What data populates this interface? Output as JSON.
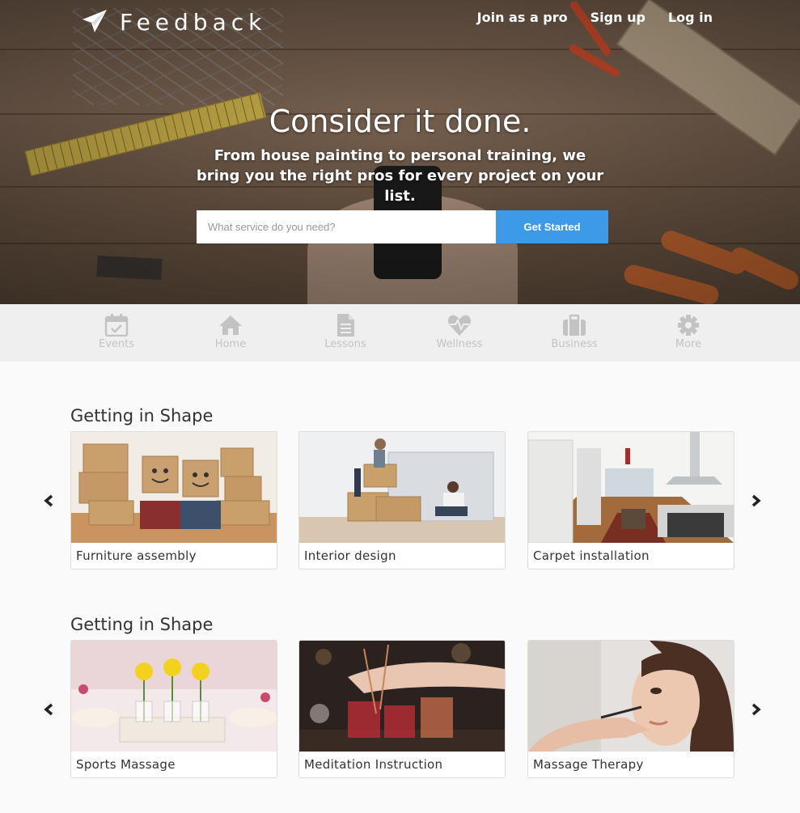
{
  "header": {
    "logo_text": "Feedback",
    "nav": [
      "Join as a pro",
      "Sign up",
      "Log in"
    ]
  },
  "hero": {
    "headline": "Consider it done.",
    "subline": "From house painting to personal training, we bring you the right pros for every project on your list.",
    "search_placeholder": "What service do you need?",
    "button_label": "Get Started",
    "button_color": "#3d9ae8"
  },
  "categories": [
    {
      "label": "Events",
      "icon": "calendar-check-icon"
    },
    {
      "label": "Home",
      "icon": "home-icon"
    },
    {
      "label": "Lessons",
      "icon": "document-icon"
    },
    {
      "label": "Wellness",
      "icon": "heartbeat-icon"
    },
    {
      "label": "Business",
      "icon": "briefcase-icon"
    },
    {
      "label": "More",
      "icon": "gear-icon"
    }
  ],
  "sections": [
    {
      "title": "Getting in Shape",
      "cards": [
        "Furniture assembly",
        "Interior design",
        "Carpet installation"
      ]
    },
    {
      "title": "Getting in Shape",
      "cards": [
        "Sports Massage",
        "Meditation Instruction",
        "Massage Therapy"
      ]
    }
  ]
}
